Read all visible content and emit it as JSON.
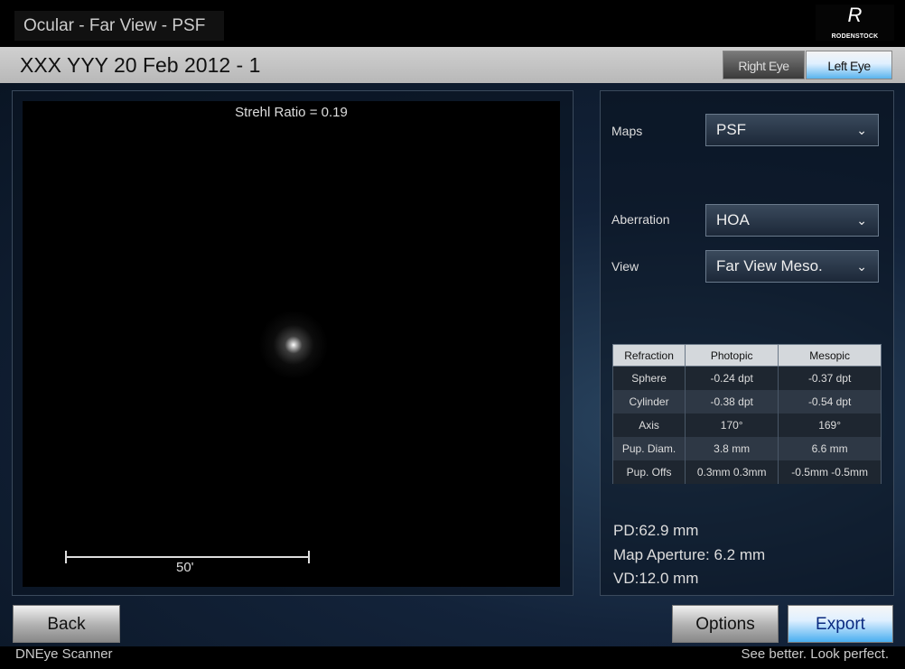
{
  "header": {
    "title": "Ocular - Far View - PSF",
    "logo_text": "RODENSTOCK",
    "patient": "XXX YYY 20 Feb 2012 - 1"
  },
  "eye_toggle": {
    "right": "Right Eye",
    "left": "Left Eye",
    "selected": "Left Eye"
  },
  "psf_view": {
    "strehl": "Strehl Ratio = 0.19",
    "scale_label": "50'"
  },
  "controls": {
    "maps": {
      "label": "Maps",
      "value": "PSF"
    },
    "aberration": {
      "label": "Aberration",
      "value": "HOA"
    },
    "view": {
      "label": "View",
      "value": "Far View Meso."
    }
  },
  "refraction": {
    "headers": [
      "Refraction",
      "Photopic",
      "Mesopic"
    ],
    "rows": [
      [
        "Sphere",
        "-0.24 dpt",
        "-0.37 dpt"
      ],
      [
        "Cylinder",
        "-0.38 dpt",
        "-0.54 dpt"
      ],
      [
        "Axis",
        "170°",
        "169°"
      ],
      [
        "Pup. Diam.",
        "3.8 mm",
        "6.6 mm"
      ],
      [
        "Pup. Offs",
        "0.3mm 0.3mm",
        "-0.5mm -0.5mm"
      ]
    ]
  },
  "info": {
    "pd": "PD:62.9 mm",
    "aperture": "Map Aperture: 6.2 mm",
    "vd": "VD:12.0 mm"
  },
  "buttons": {
    "back": "Back",
    "options": "Options",
    "export": "Export"
  },
  "footer": {
    "left": "DNEye Scanner",
    "right": "See better. Look perfect."
  },
  "colors": {
    "accent": "#4aaef0",
    "background": "#13233a"
  }
}
